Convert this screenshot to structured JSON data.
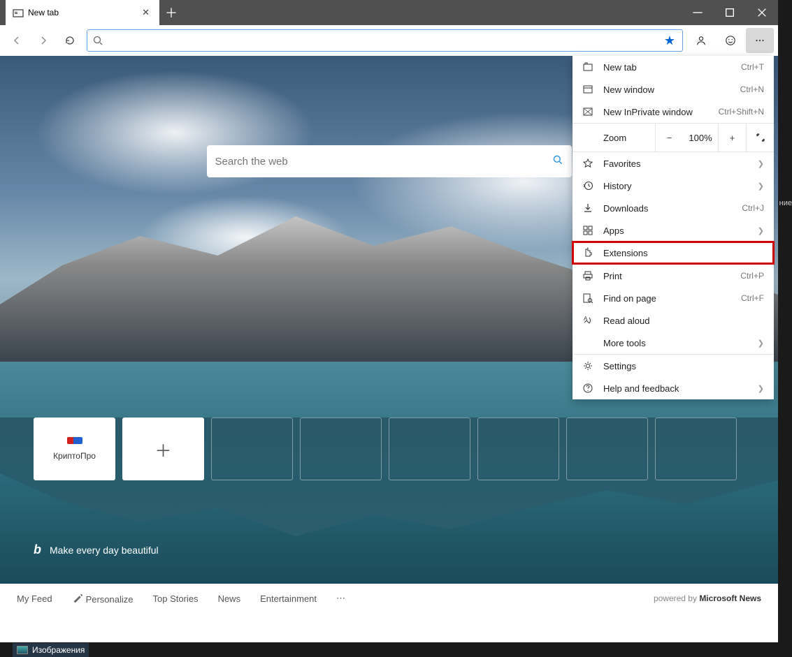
{
  "tab": {
    "title": "New tab"
  },
  "addressbar": {
    "placeholder": ""
  },
  "newtab": {
    "search_placeholder": "Search the web",
    "tiles": [
      "КриптоПро"
    ],
    "tagline": "Make every day beautiful",
    "footer": {
      "items": [
        "My Feed",
        "Personalize",
        "Top Stories",
        "News",
        "Entertainment"
      ],
      "powered_prefix": "powered by ",
      "powered_brand": "Microsoft News"
    }
  },
  "menu": {
    "new_tab": {
      "label": "New tab",
      "shortcut": "Ctrl+T"
    },
    "new_window": {
      "label": "New window",
      "shortcut": "Ctrl+N"
    },
    "new_inprivate": {
      "label": "New InPrivate window",
      "shortcut": "Ctrl+Shift+N"
    },
    "zoom": {
      "label": "Zoom",
      "value": "100%"
    },
    "favorites": {
      "label": "Favorites"
    },
    "history": {
      "label": "History"
    },
    "downloads": {
      "label": "Downloads",
      "shortcut": "Ctrl+J"
    },
    "apps": {
      "label": "Apps"
    },
    "extensions": {
      "label": "Extensions"
    },
    "print": {
      "label": "Print",
      "shortcut": "Ctrl+P"
    },
    "find": {
      "label": "Find on page",
      "shortcut": "Ctrl+F"
    },
    "read_aloud": {
      "label": "Read aloud"
    },
    "more_tools": {
      "label": "More tools"
    },
    "settings": {
      "label": "Settings"
    },
    "help": {
      "label": "Help and feedback"
    }
  },
  "taskbar_peek": "Изображения",
  "side_peek": "ние"
}
